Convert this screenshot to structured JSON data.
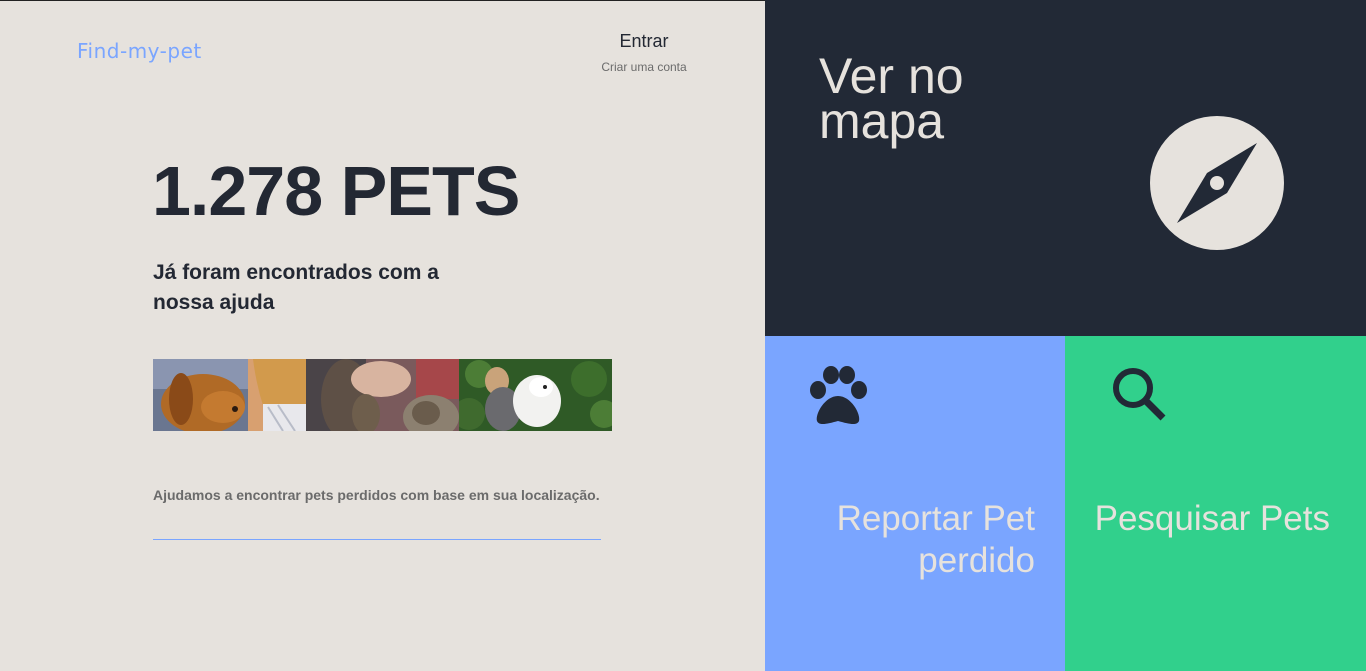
{
  "brand": {
    "logo": "Find-my-pet"
  },
  "auth": {
    "login_label": "Entrar",
    "signup_label": "Criar uma conta"
  },
  "hero": {
    "count": "1.278 PETS",
    "subtitle": "Já foram encontrados com a nossa ajuda",
    "description": "Ajudamos a encontrar pets perdidos com base em sua localização."
  },
  "photos": [
    "dog-photo",
    "cat-hand-photo",
    "woman-samoyed-photo"
  ],
  "tiles": {
    "map": {
      "label": "Ver no mapa",
      "icon": "compass-icon"
    },
    "report": {
      "label": "Reportar Pet perdido",
      "icon": "paw-icon"
    },
    "search": {
      "label": "Pesquisar Pets",
      "icon": "search-icon"
    }
  },
  "colors": {
    "background": "#e6e2dd",
    "dark": "#222936",
    "blue": "#7aa5ff",
    "green": "#31d08c"
  }
}
